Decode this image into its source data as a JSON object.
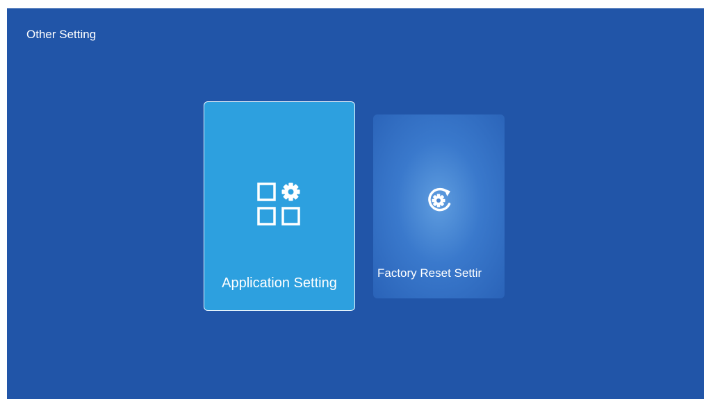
{
  "page": {
    "title": "Other Setting"
  },
  "cards": [
    {
      "label": "Application Setting",
      "icon": "apps-gear-icon",
      "focused": true
    },
    {
      "label": "Factory Reset Settir",
      "icon": "reset-gear-icon",
      "focused": false
    }
  ],
  "colors": {
    "background": "#2155a8",
    "focused_card": "#2da0df",
    "card": "#3a79cc",
    "text": "#ffffff"
  }
}
